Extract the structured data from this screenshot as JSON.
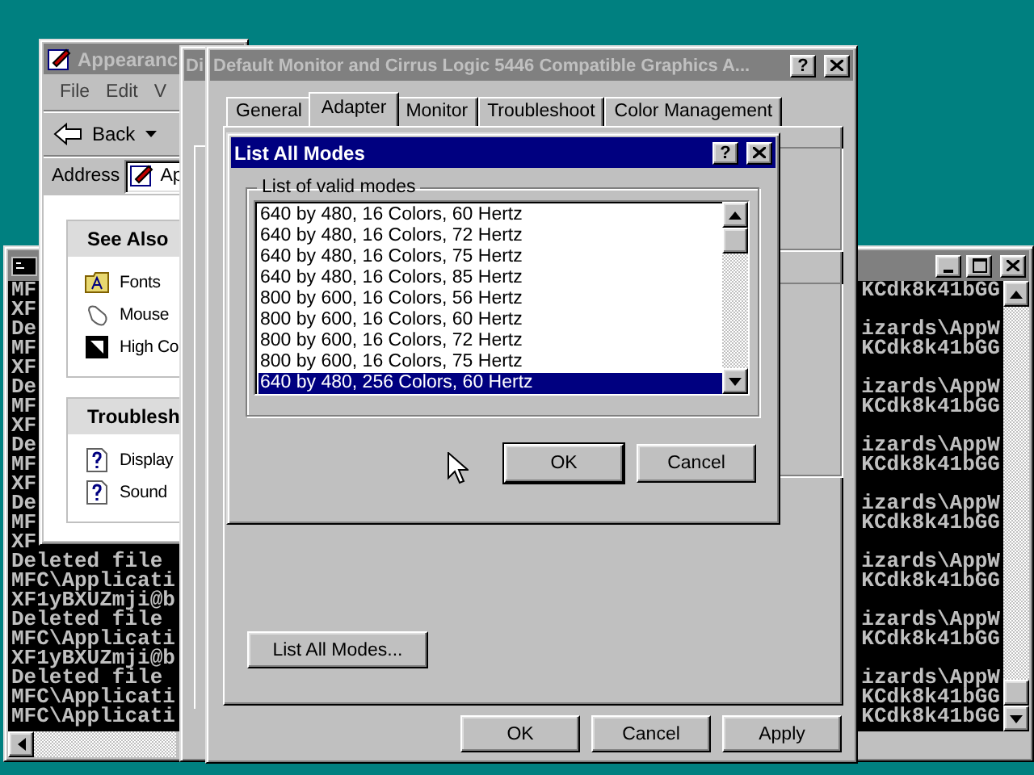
{
  "console": {
    "lines": [
      {
        "left": "MF",
        "right": "KCdk8k41bGG"
      },
      {
        "left": "XF"
      },
      {
        "left": "De",
        "right": "izards\\AppW"
      },
      {
        "left": "MF",
        "right": "KCdk8k41bGG"
      },
      {
        "left": "XF"
      },
      {
        "left": "De",
        "right": "izards\\AppW"
      },
      {
        "left": "MF",
        "right": "KCdk8k41bGG"
      },
      {
        "left": "XF"
      },
      {
        "left": "De",
        "right": "izards\\AppW"
      },
      {
        "left": "MF",
        "right": "KCdk8k41bGG"
      },
      {
        "left": "XF"
      },
      {
        "left": "De",
        "right": "izards\\AppW"
      },
      {
        "left": "MF",
        "right": "KCdk8k41bGG"
      },
      {
        "left": "XF"
      },
      {
        "left": "Deleted file",
        "right": "izards\\AppW"
      },
      {
        "left": "MFC\\Applicati",
        "right": "KCdk8k41bGG"
      },
      {
        "left": "XF1yBXUZmji@b"
      },
      {
        "left": "Deleted file",
        "right": "izards\\AppW"
      },
      {
        "left": "MFC\\Applicati",
        "right": "KCdk8k41bGG"
      },
      {
        "left": "XF1yBXUZmji@b"
      },
      {
        "left": "Deleted file",
        "right": "izards\\AppW"
      },
      {
        "left": "MFC\\Applicati",
        "right": "KCdk8k41bGG"
      },
      {
        "left": "MFC\\Applicati",
        "right": "KCdk8k41bGG"
      }
    ]
  },
  "explorer": {
    "title": "Appearanc",
    "menu": [
      "File",
      "Edit",
      "V"
    ],
    "back": "Back",
    "address_label": "Address",
    "address_value": "Ap",
    "panels": [
      {
        "heading": "See Also",
        "items": [
          {
            "label": "Fonts",
            "kind": "fonts"
          },
          {
            "label": "Mouse",
            "kind": "mouse"
          },
          {
            "label": "High Co",
            "kind": "contrast"
          }
        ]
      },
      {
        "heading": "Troublesh",
        "items": [
          {
            "label": "Display",
            "kind": "help"
          },
          {
            "label": "Sound",
            "kind": "help"
          }
        ]
      }
    ]
  },
  "display_window": {
    "title": "Di"
  },
  "adapter_window": {
    "title": "Default Monitor and Cirrus Logic 5446 Compatible Graphics A...",
    "help": "?",
    "tabs": [
      {
        "label": "General",
        "selected": false
      },
      {
        "label": "Adapter",
        "selected": true
      },
      {
        "label": "Monitor",
        "selected": false
      },
      {
        "label": "Troubleshoot",
        "selected": false
      },
      {
        "label": "Color Management",
        "selected": false
      }
    ],
    "list_all_modes_button": "List All Modes...",
    "buttons": [
      "OK",
      "Cancel",
      "Apply"
    ]
  },
  "modes_dialog": {
    "title": "List All Modes",
    "help": "?",
    "group_label": "List of valid modes",
    "modes": [
      {
        "label": "640 by 480, 16 Colors, 60 Hertz",
        "selected": false
      },
      {
        "label": "640 by 480, 16 Colors, 72 Hertz",
        "selected": false
      },
      {
        "label": "640 by 480, 16 Colors, 75 Hertz",
        "selected": false
      },
      {
        "label": "640 by 480, 16 Colors, 85 Hertz",
        "selected": false
      },
      {
        "label": "800 by 600, 16 Colors, 56 Hertz",
        "selected": false
      },
      {
        "label": "800 by 600, 16 Colors, 60 Hertz",
        "selected": false
      },
      {
        "label": "800 by 600, 16 Colors, 72 Hertz",
        "selected": false
      },
      {
        "label": "800 by 600, 16 Colors, 75 Hertz",
        "selected": false
      },
      {
        "label": "640 by 480, 256 Colors, 60 Hertz",
        "selected": true
      }
    ],
    "buttons": [
      {
        "label": "OK",
        "default": true
      },
      {
        "label": "Cancel",
        "default": false
      }
    ]
  }
}
